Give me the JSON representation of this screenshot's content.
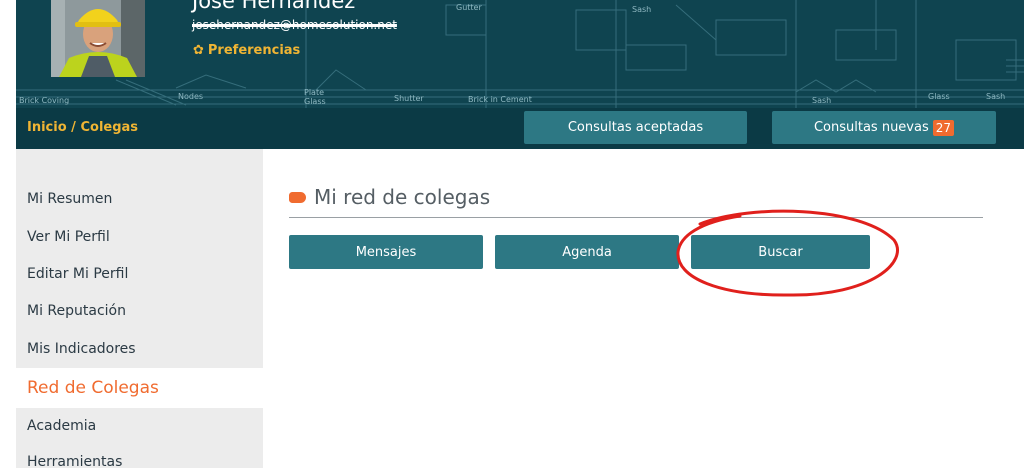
{
  "user": {
    "name": "Jose Hernandez",
    "email": "josehernandez@homesolution.net",
    "preferences_label": "Preferencias",
    "preferences_icon": "gear-icon"
  },
  "breadcrumb": {
    "home": "Inicio",
    "separator": " / ",
    "current": "Colegas"
  },
  "nav": {
    "accepted_label": "Consultas aceptadas",
    "new_label": "Consultas nuevas",
    "new_count": "27"
  },
  "sidebar": {
    "items": [
      {
        "label": "Mi Resumen"
      },
      {
        "label": "Ver Mi Perfil"
      },
      {
        "label": "Editar Mi Perfil"
      },
      {
        "label": "Mi Reputación"
      },
      {
        "label": "Mis Indicadores"
      },
      {
        "label": "Red de Colegas"
      },
      {
        "label": "Academia"
      },
      {
        "label": "Herramientas"
      }
    ],
    "active_index": 5
  },
  "main": {
    "title": "Mi red de colegas",
    "buttons": {
      "mensajes": "Mensajes",
      "agenda": "Agenda",
      "buscar": "Buscar"
    }
  },
  "blueprint_labels": [
    "Brick Coving",
    "Nodes",
    "Plate Glass",
    "Shutter",
    "Brick in Cement",
    "Gutter",
    "Sash",
    "Glass",
    "Sash",
    "Sash"
  ],
  "colors": {
    "header_bg": "#0f4450",
    "navbar_bg": "#0b3a45",
    "button_bg": "#2d7884",
    "accent_orange": "#f06b2f",
    "accent_yellow": "#f0b534",
    "annotation_red": "#e0201c"
  }
}
